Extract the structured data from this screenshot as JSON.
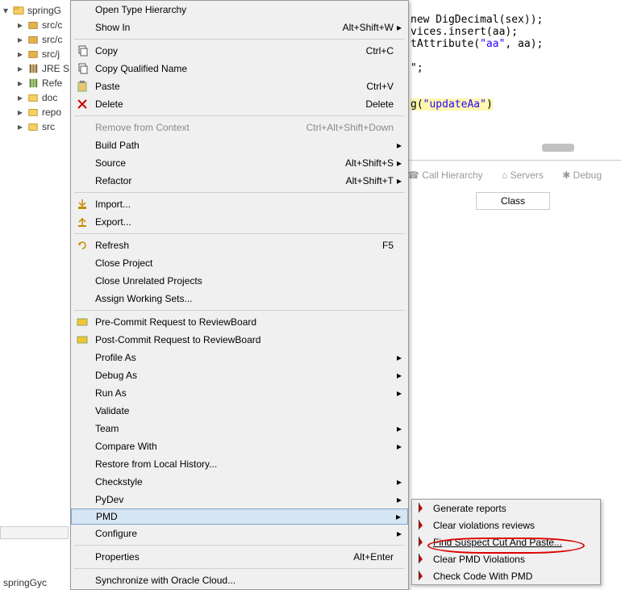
{
  "project": {
    "root": "springG",
    "children": [
      "src/c",
      "src/c",
      "src/j",
      "JRE S",
      "Refe",
      "doc",
      "repo",
      "src"
    ]
  },
  "status": {
    "project_label": "springGyc"
  },
  "editor": {
    "l1a": "new",
    "l1b": " DigDecimal(sex));",
    "l2": "vices.insert(aa);",
    "l3a": "tAttribute(",
    "l3b": "\"aa\"",
    "l3c": ", aa);",
    "l4": "\";",
    "l5a": "g(",
    "l5b": "\"updateAa\"",
    "l5c": ")"
  },
  "views": {
    "call_hierarchy": "Call Hierarchy",
    "servers": "Servers",
    "debug": "Debug",
    "class_header": "Class"
  },
  "menu": [
    {
      "label": "Open Type Hierarchy",
      "shortcut": "",
      "icon": ""
    },
    {
      "label": "Show In",
      "shortcut": "Alt+Shift+W",
      "icon": "",
      "has_sub": true
    },
    {
      "type": "sep"
    },
    {
      "label": "Copy",
      "shortcut": "Ctrl+C",
      "icon": "copy"
    },
    {
      "label": "Copy Qualified Name",
      "shortcut": "",
      "icon": "copyq"
    },
    {
      "label": "Paste",
      "shortcut": "Ctrl+V",
      "icon": "paste"
    },
    {
      "label": "Delete",
      "shortcut": "Delete",
      "icon": "delete"
    },
    {
      "type": "sep"
    },
    {
      "label": "Remove from Context",
      "shortcut": "Ctrl+Alt+Shift+Down",
      "disabled": true
    },
    {
      "label": "Build Path",
      "has_sub": true
    },
    {
      "label": "Source",
      "shortcut": "Alt+Shift+S",
      "has_sub": true
    },
    {
      "label": "Refactor",
      "shortcut": "Alt+Shift+T",
      "has_sub": true
    },
    {
      "type": "sep"
    },
    {
      "label": "Import...",
      "icon": "import"
    },
    {
      "label": "Export...",
      "icon": "export"
    },
    {
      "type": "sep"
    },
    {
      "label": "Refresh",
      "shortcut": "F5",
      "icon": "refresh"
    },
    {
      "label": "Close Project"
    },
    {
      "label": "Close Unrelated Projects"
    },
    {
      "label": "Assign Working Sets..."
    },
    {
      "type": "sep"
    },
    {
      "label": "Pre-Commit Request to ReviewBoard",
      "icon": "rb"
    },
    {
      "label": "Post-Commit Request to ReviewBoard",
      "icon": "rb"
    },
    {
      "label": "Profile As",
      "has_sub": true
    },
    {
      "label": "Debug As",
      "has_sub": true
    },
    {
      "label": "Run As",
      "has_sub": true
    },
    {
      "label": "Validate"
    },
    {
      "label": "Team",
      "has_sub": true
    },
    {
      "label": "Compare With",
      "has_sub": true
    },
    {
      "label": "Restore from Local History..."
    },
    {
      "label": "Checkstyle",
      "has_sub": true
    },
    {
      "label": "PyDev",
      "has_sub": true
    },
    {
      "label": "PMD",
      "has_sub": true,
      "selected": true
    },
    {
      "label": "Configure",
      "has_sub": true
    },
    {
      "type": "sep"
    },
    {
      "label": "Properties",
      "shortcut": "Alt+Enter"
    },
    {
      "type": "sep"
    },
    {
      "label": "Synchronize with Oracle Cloud..."
    }
  ],
  "submenu": [
    {
      "label": "Generate reports"
    },
    {
      "label": "Clear violations reviews"
    },
    {
      "label": "Find Suspect Cut And Paste...",
      "highlighted": true
    },
    {
      "label": "Clear PMD Violations"
    },
    {
      "label": "Check Code With PMD"
    }
  ]
}
